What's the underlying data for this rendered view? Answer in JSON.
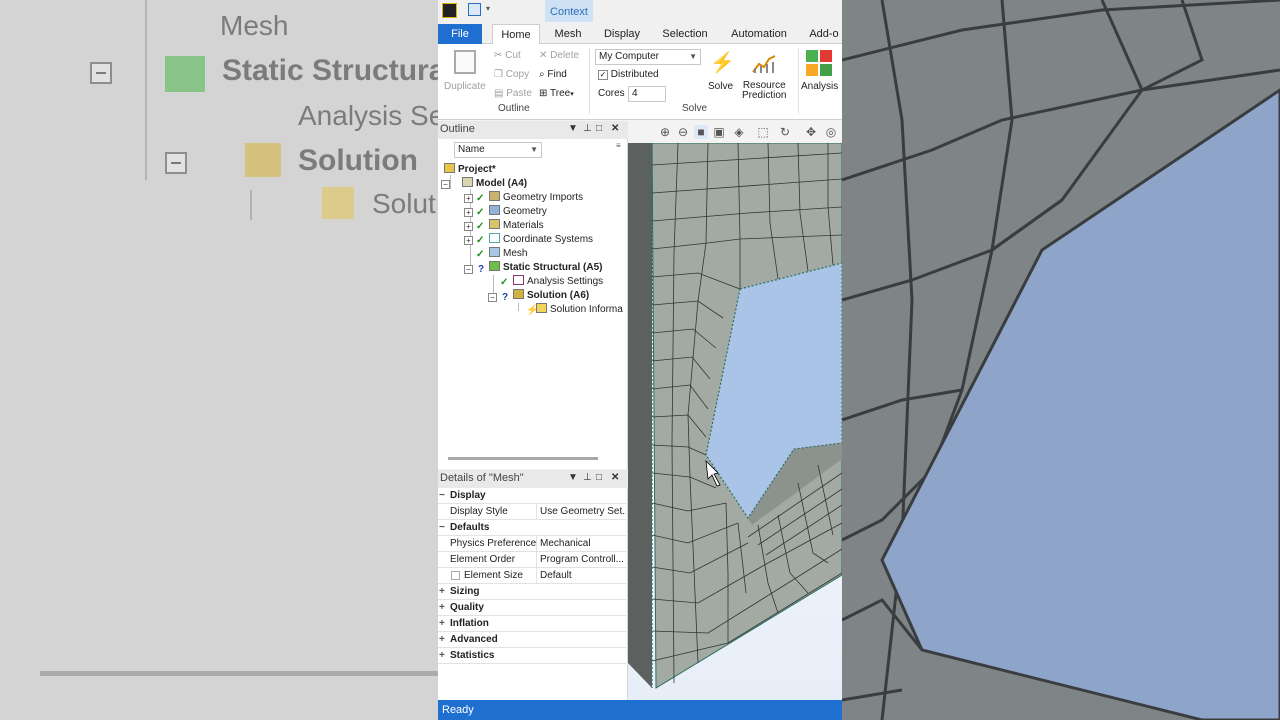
{
  "background": {
    "left_tree": {
      "mesh": "Mesh",
      "static_structural": "Static Structural",
      "analysis_settings": "Analysis Se",
      "solution": "Solution",
      "solution_info": "Solut"
    }
  },
  "qat": {
    "context_label": "Context"
  },
  "tabs": [
    {
      "label": "File"
    },
    {
      "label": "Home"
    },
    {
      "label": "Mesh"
    },
    {
      "label": "Display"
    },
    {
      "label": "Selection"
    },
    {
      "label": "Automation"
    },
    {
      "label": "Add-o"
    }
  ],
  "ribbon": {
    "duplicate": "Duplicate",
    "cut": "Cut",
    "copy": "Copy",
    "paste": "Paste",
    "delete": "Delete",
    "find": "Find",
    "tree": "Tree",
    "outline_group": "Outline",
    "machine": "My Computer",
    "distributed": "Distributed",
    "distributed_checked": true,
    "cores_label": "Cores",
    "cores_value": "4",
    "solve_group": "Solve",
    "solve": "Solve",
    "resource1": "Resource",
    "resource2": "Prediction",
    "analysis": "Analysis"
  },
  "outline": {
    "title": "Outline",
    "filter": "Name",
    "tree": [
      {
        "label": "Project*",
        "bold": true
      },
      {
        "label": "Model (A4)",
        "bold": true
      },
      {
        "label": "Geometry Imports"
      },
      {
        "label": "Geometry"
      },
      {
        "label": "Materials"
      },
      {
        "label": "Coordinate Systems"
      },
      {
        "label": "Mesh"
      },
      {
        "label": "Static Structural (A5)",
        "bold": true
      },
      {
        "label": "Analysis Settings"
      },
      {
        "label": "Solution (A6)",
        "bold": true
      },
      {
        "label": "Solution Informa"
      }
    ]
  },
  "details": {
    "title": "Details of \"Mesh\"",
    "rows": [
      {
        "type": "cat",
        "label": "Display",
        "sign": "−"
      },
      {
        "type": "prop",
        "key": "Display Style",
        "value": "Use Geometry Set..."
      },
      {
        "type": "cat",
        "label": "Defaults",
        "sign": "−"
      },
      {
        "type": "prop",
        "key": "Physics Preference",
        "value": "Mechanical"
      },
      {
        "type": "prop",
        "key": "Element Order",
        "value": "Program Controll..."
      },
      {
        "type": "prop",
        "key": "Element Size",
        "value": "Default",
        "checkbox": true
      },
      {
        "type": "cat",
        "label": "Sizing",
        "sign": "+"
      },
      {
        "type": "cat",
        "label": "Quality",
        "sign": "+"
      },
      {
        "type": "cat",
        "label": "Inflation",
        "sign": "+"
      },
      {
        "type": "cat",
        "label": "Advanced",
        "sign": "+"
      },
      {
        "type": "cat",
        "label": "Statistics",
        "sign": "+"
      }
    ]
  },
  "status": "Ready"
}
